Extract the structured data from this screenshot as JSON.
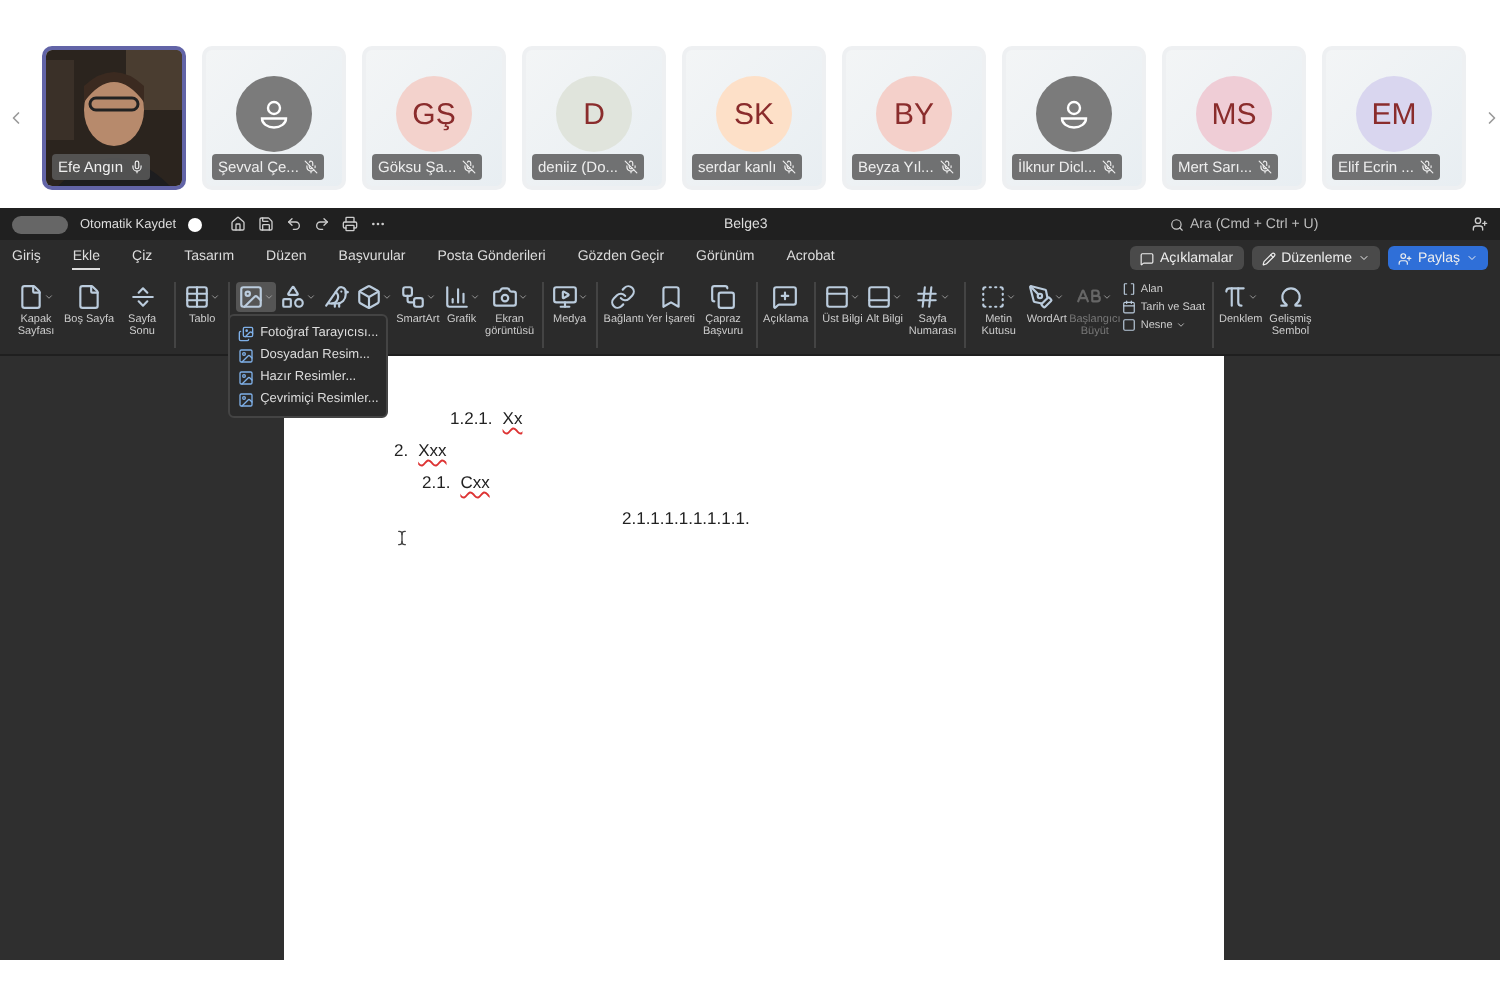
{
  "participants": [
    {
      "name": "Efe Angın",
      "kind": "video",
      "muted": false,
      "selected": true
    },
    {
      "name": "Şevval Çe...",
      "kind": "silhouette",
      "muted": true,
      "selected": false
    },
    {
      "name": "Göksu Şa...",
      "kind": "initials",
      "initials": "GŞ",
      "color": "#f3d2cc",
      "muted": true,
      "selected": false
    },
    {
      "name": "deniiz (Do...",
      "kind": "initials",
      "initials": "D",
      "color": "#e0e4dc",
      "muted": true,
      "selected": false
    },
    {
      "name": "serdar kanlı",
      "kind": "initials",
      "initials": "SK",
      "color": "#fde0c8",
      "muted": true,
      "selected": false
    },
    {
      "name": "Beyza Yıl...",
      "kind": "initials",
      "initials": "BY",
      "color": "#f4d0ca",
      "muted": true,
      "selected": false
    },
    {
      "name": "İlknur Dicl...",
      "kind": "silhouette",
      "muted": true,
      "selected": false
    },
    {
      "name": "Mert Sarı...",
      "kind": "initials",
      "initials": "MS",
      "color": "#efcdd6",
      "muted": true,
      "selected": false
    },
    {
      "name": "Elif Ecrin ...",
      "kind": "initials",
      "initials": "EM",
      "color": "#d9d6ef",
      "muted": true,
      "selected": false
    }
  ],
  "word": {
    "autosave": {
      "label": "Otomatik Kaydet",
      "on": false
    },
    "title": "Belge3",
    "search": {
      "placeholder": "Ara (Cmd + Ctrl + U)"
    },
    "tabs": [
      {
        "label": "Giriş",
        "selected": false
      },
      {
        "label": "Ekle",
        "selected": true
      },
      {
        "label": "Çiz",
        "selected": false
      },
      {
        "label": "Tasarım",
        "selected": false
      },
      {
        "label": "Düzen",
        "selected": false
      },
      {
        "label": "Başvurular",
        "selected": false
      },
      {
        "label": "Posta Gönderileri",
        "selected": false
      },
      {
        "label": "Gözden Geçir",
        "selected": false
      },
      {
        "label": "Görünüm",
        "selected": false
      },
      {
        "label": "Acrobat",
        "selected": false
      }
    ],
    "buttons": [
      {
        "label": "Açıklamalar",
        "kind": "plain"
      },
      {
        "label": "Düzenleme",
        "kind": "menu"
      },
      {
        "label": "Paylaş",
        "kind": "primary"
      }
    ],
    "ribbon": [
      {
        "items": [
          {
            "label": "Kapak Sayfası",
            "dropdown": true
          },
          {
            "label": "Boş Sayfa"
          },
          {
            "label": "Sayfa Sonu"
          }
        ]
      },
      {
        "items": [
          {
            "label": "Tablo",
            "dropdown": true
          }
        ]
      },
      {
        "items": [
          {
            "dropdown": true,
            "selected": true
          },
          {
            "dropdown": true
          },
          {
            "dropdown": false
          },
          {
            "dropdown": true
          },
          {
            "label": "SmartArt",
            "dropdown": true
          },
          {
            "label": "Grafik",
            "dropdown": true
          },
          {
            "label": "Ekran görüntüsü",
            "dropdown": true
          }
        ]
      },
      {
        "items": [
          {
            "label": "Medya",
            "dropdown": true
          }
        ]
      },
      {
        "items": [
          {
            "label": "Bağlantı"
          },
          {
            "label": "Yer İşareti"
          },
          {
            "label": "Çapraz Başvuru"
          }
        ]
      },
      {
        "items": [
          {
            "label": "Açıklama"
          }
        ]
      },
      {
        "items": [
          {
            "label": "Üst Bilgi",
            "dropdown": true
          },
          {
            "label": "Alt Bilgi",
            "dropdown": true
          },
          {
            "label": "Sayfa Numarası",
            "dropdown": true
          }
        ]
      },
      {
        "items": [
          {
            "label": "Metin Kutusu",
            "dropdown": true
          },
          {
            "label": "WordArt",
            "dropdown": true
          },
          {
            "label": "Başlangıcı Büyüt",
            "dropdown": true,
            "disabled": true
          },
          {
            "label": "Alan",
            "kind": "small"
          },
          {
            "label": "Tarih ve Saat",
            "kind": "small"
          },
          {
            "label": "Nesne",
            "kind": "small",
            "dropdown": true
          }
        ]
      },
      {
        "items": [
          {
            "label": "Denklem",
            "dropdown": true
          },
          {
            "label": "Gelişmiş Sembol"
          }
        ]
      }
    ],
    "picture_menu": [
      "Fotoğraf Tarayıcısı...",
      "Dosyadan Resim...",
      "Hazır Resimler...",
      "Çevrimiçi Resimler..."
    ],
    "document": [
      {
        "number": "1.2.1.",
        "text": "Xx",
        "misspelled": true
      },
      {
        "number": "2.",
        "text": "Xxx",
        "misspelled": true
      },
      {
        "number": "2.1.",
        "text": "Cxx",
        "misspelled": true
      },
      {
        "number": "2.1.1.1.1.1.1.1.1."
      }
    ]
  }
}
